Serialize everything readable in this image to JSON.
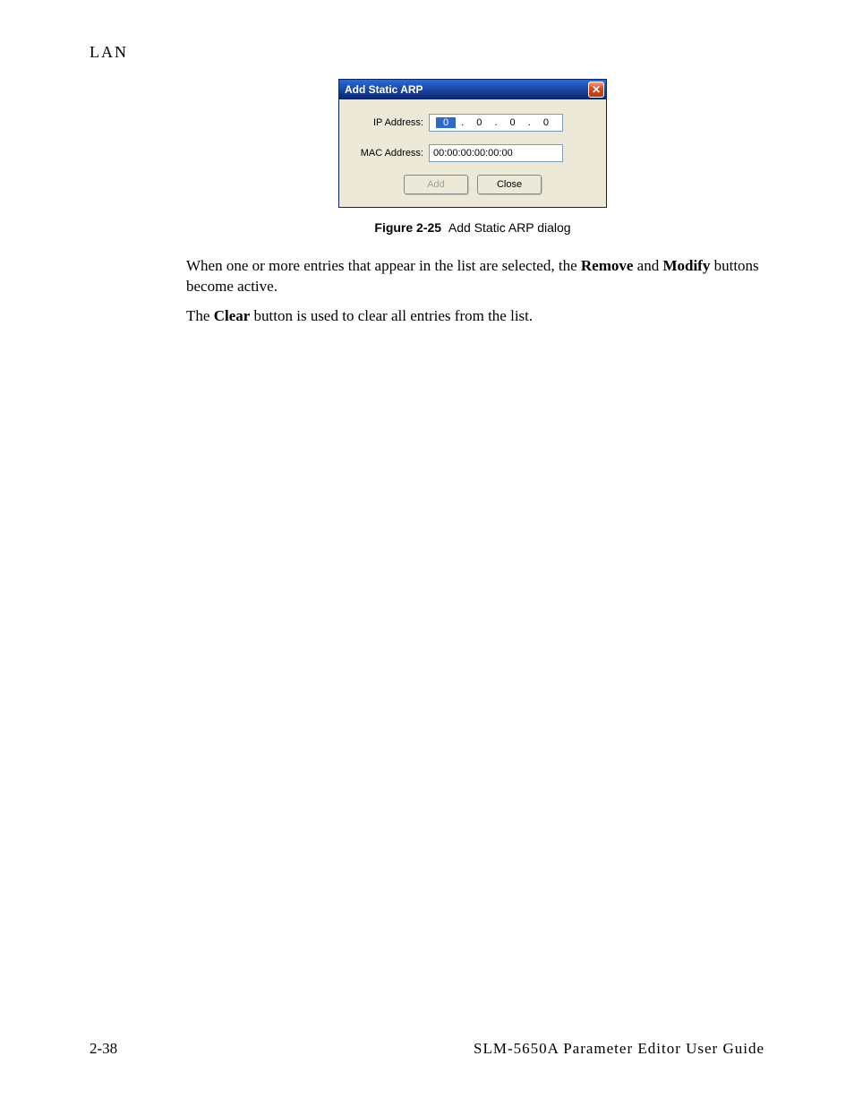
{
  "header": {
    "section": "LAN"
  },
  "dialog": {
    "title": "Add Static ARP",
    "ip_label": "IP Address:",
    "ip_octets": [
      "0",
      "0",
      "0",
      "0"
    ],
    "mac_label": "MAC Address:",
    "mac_value": "00:00:00:00:00:00",
    "add_label": "Add",
    "close_label": "Close"
  },
  "figure": {
    "number": "Figure 2-25",
    "caption": "Add Static ARP dialog"
  },
  "paragraphs": {
    "p1_a": "When one or more entries that appear in the list are selected, the ",
    "p1_remove": "Remove",
    "p1_b": " and ",
    "p1_modify": "Modify",
    "p1_c": " buttons become active.",
    "p2_a": "The ",
    "p2_clear": "Clear",
    "p2_b": " button is used to clear all entries from the list."
  },
  "footer": {
    "page": "2-38",
    "doc_title": "SLM-5650A Parameter Editor User Guide"
  }
}
